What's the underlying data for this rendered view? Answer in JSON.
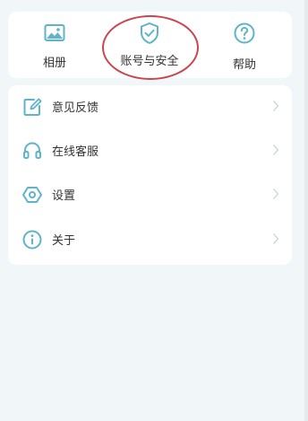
{
  "colors": {
    "accent": "#5fb3cb",
    "highlight": "#c9464e",
    "background": "#f1f7f8",
    "card": "#ffffff"
  },
  "shortcuts": [
    {
      "id": "album",
      "label": "相册",
      "icon": "image-icon"
    },
    {
      "id": "account",
      "label": "账号与安全",
      "icon": "shield-check-icon"
    },
    {
      "id": "help",
      "label": "帮助",
      "icon": "question-circle-icon"
    }
  ],
  "menu": {
    "items": [
      {
        "id": "feedback",
        "label": "意见反馈",
        "icon": "edit-icon"
      },
      {
        "id": "service",
        "label": "在线客服",
        "icon": "headset-icon"
      },
      {
        "id": "settings",
        "label": "设置",
        "icon": "settings-icon"
      },
      {
        "id": "about",
        "label": "关于",
        "icon": "info-icon"
      }
    ]
  }
}
